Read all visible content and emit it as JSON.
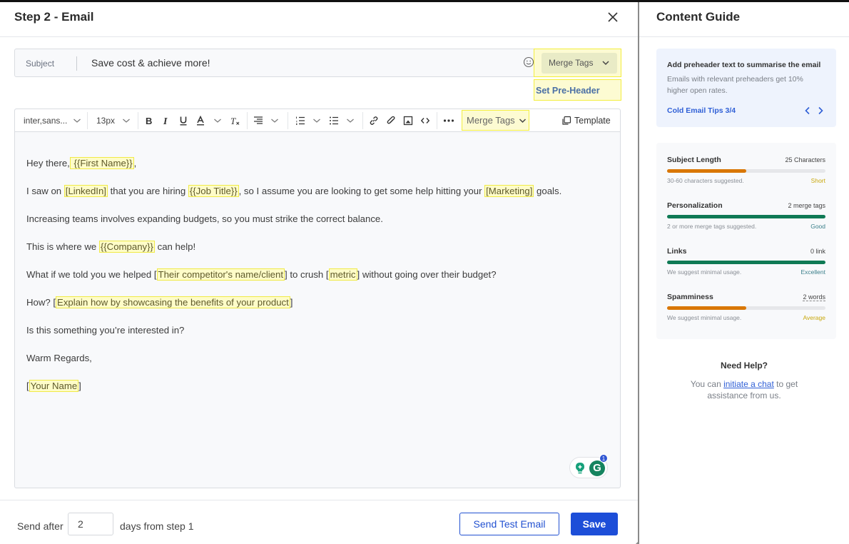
{
  "header": {
    "title": "Step 2 - Email"
  },
  "subject": {
    "label": "Subject",
    "value": "Save cost & achieve more!",
    "merge_tags_label": "Merge Tags",
    "set_preheader_label": "Set Pre-Header"
  },
  "toolbar": {
    "font_family": "inter,sans...",
    "font_size": "13px",
    "merge_tags_label": "Merge Tags",
    "template_label": "Template"
  },
  "email_body": {
    "lines": [
      {
        "parts": [
          {
            "t": "Hey there,"
          },
          {
            "t": " {{First Name}}",
            "tag": true
          },
          {
            "t": ","
          }
        ]
      },
      {
        "parts": [
          {
            "t": "I saw on "
          },
          {
            "t": "[LinkedIn]",
            "tag": true
          },
          {
            "t": " that you are hiring "
          },
          {
            "t": "{{Job Title}}",
            "tag": true
          },
          {
            "t": ", so I assume you are looking to get some help hitting your "
          },
          {
            "t": "[Marketing]",
            "tag": true
          },
          {
            "t": " goals."
          }
        ]
      },
      {
        "parts": [
          {
            "t": "Increasing teams involves expanding budgets, so you must strike the correct balance."
          }
        ]
      },
      {
        "parts": [
          {
            "t": "This is where we "
          },
          {
            "t": "{{Company}}",
            "tag": true
          },
          {
            "t": " can help!"
          }
        ]
      },
      {
        "parts": [
          {
            "t": "What if we told you we helped ["
          },
          {
            "t": "Their competitor's name/client",
            "tag": true
          },
          {
            "t": "] to crush ["
          },
          {
            "t": "metric",
            "tag": true
          },
          {
            "t": "] without going over their budget?"
          }
        ]
      },
      {
        "parts": [
          {
            "t": "How? ["
          },
          {
            "t": "Explain how by showcasing the benefits of your product",
            "tag": true
          },
          {
            "t": "]"
          }
        ]
      },
      {
        "parts": [
          {
            "t": "Is this something you’re interested in?"
          }
        ]
      },
      {
        "parts": [
          {
            "t": "Warm Regards,"
          }
        ]
      },
      {
        "parts": [
          {
            "t": "["
          },
          {
            "t": "Your Name",
            "tag": true
          },
          {
            "t": "]"
          }
        ]
      }
    ]
  },
  "grammarly": {
    "badge_count": "1",
    "letter": "G"
  },
  "footer": {
    "send_after_label": "Send after",
    "days_value": "2",
    "days_suffix": "days from step 1",
    "send_test_label": "Send Test Email",
    "save_label": "Save"
  },
  "content_guide": {
    "title": "Content Guide",
    "tip": {
      "heading": "Add preheader text to summarise the email",
      "body": "Emails with relevant preheaders get 10% higher open rates.",
      "link": "Cold Email Tips 3/4"
    },
    "metrics": [
      {
        "name": "Subject Length",
        "value": "25 Characters",
        "progress": 0.5,
        "hint": "30-60 characters suggested.",
        "rating": "Short",
        "bar_color": "#d97706",
        "rating_color": "#c9a80c",
        "dashed": false
      },
      {
        "name": "Personalization",
        "value": "2 merge tags",
        "progress": 1.0,
        "hint": "2 or more merge tags suggested.",
        "rating": "Good",
        "bar_color": "#0f7a55",
        "rating_color": "#3a7f8a",
        "dashed": false
      },
      {
        "name": "Links",
        "value": "0 link",
        "progress": 1.0,
        "hint": "We suggest minimal usage.",
        "rating": "Excellent",
        "bar_color": "#0f7a55",
        "rating_color": "#3a7f8a",
        "dashed": false
      },
      {
        "name": "Spamminess",
        "value": "2 words",
        "progress": 0.5,
        "hint": "We suggest minimal usage.",
        "rating": "Average",
        "bar_color": "#d97706",
        "rating_color": "#c9a80c",
        "dashed": true
      }
    ],
    "help": {
      "title": "Need Help?",
      "prefix": "You can ",
      "link": "initiate a chat",
      "suffix": " to get assistance from us."
    }
  }
}
